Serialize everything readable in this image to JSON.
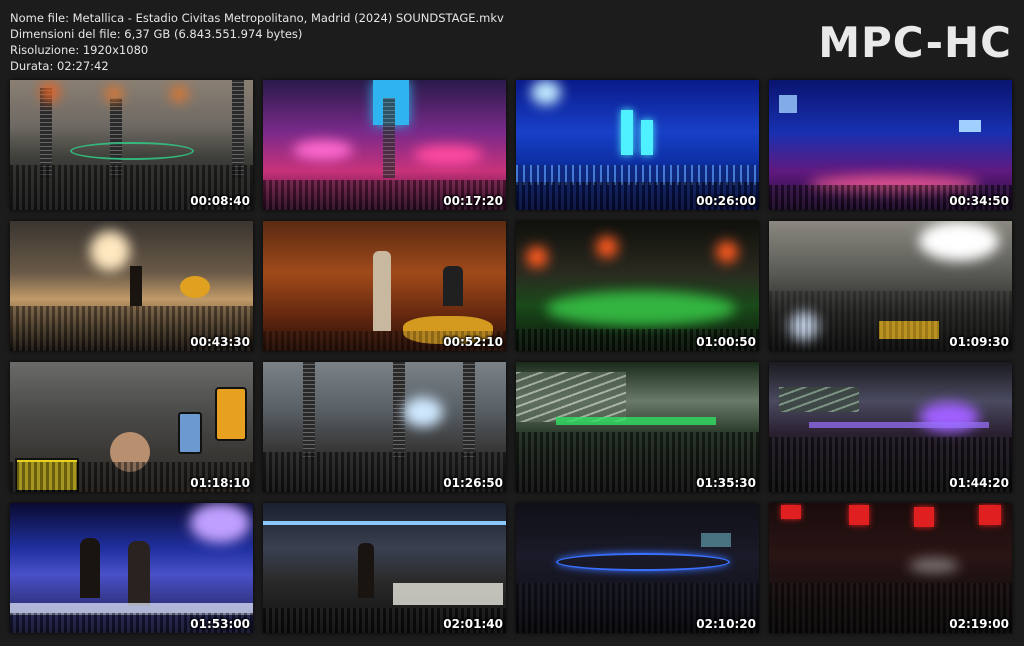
{
  "info": {
    "filename": "Nome file: Metallica - Estadio Civitas Metropolitano, Madrid (2024) SOUNDSTAGE.mkv",
    "size": "Dimensioni del file: 6,37 GB (6.843.551.974 bytes)",
    "resolution": "Risoluzione: 1920x1080",
    "duration": "Durata: 02:27:42"
  },
  "logo": "MPC-HC",
  "thumbnails": [
    {
      "time": "00:08:40"
    },
    {
      "time": "00:17:20"
    },
    {
      "time": "00:26:00"
    },
    {
      "time": "00:34:50"
    },
    {
      "time": "00:43:30"
    },
    {
      "time": "00:52:10"
    },
    {
      "time": "01:00:50"
    },
    {
      "time": "01:09:30"
    },
    {
      "time": "01:18:10"
    },
    {
      "time": "01:26:50"
    },
    {
      "time": "01:35:30"
    },
    {
      "time": "01:44:20"
    },
    {
      "time": "01:53:00"
    },
    {
      "time": "02:01:40"
    },
    {
      "time": "02:10:20"
    },
    {
      "time": "02:19:00"
    }
  ]
}
